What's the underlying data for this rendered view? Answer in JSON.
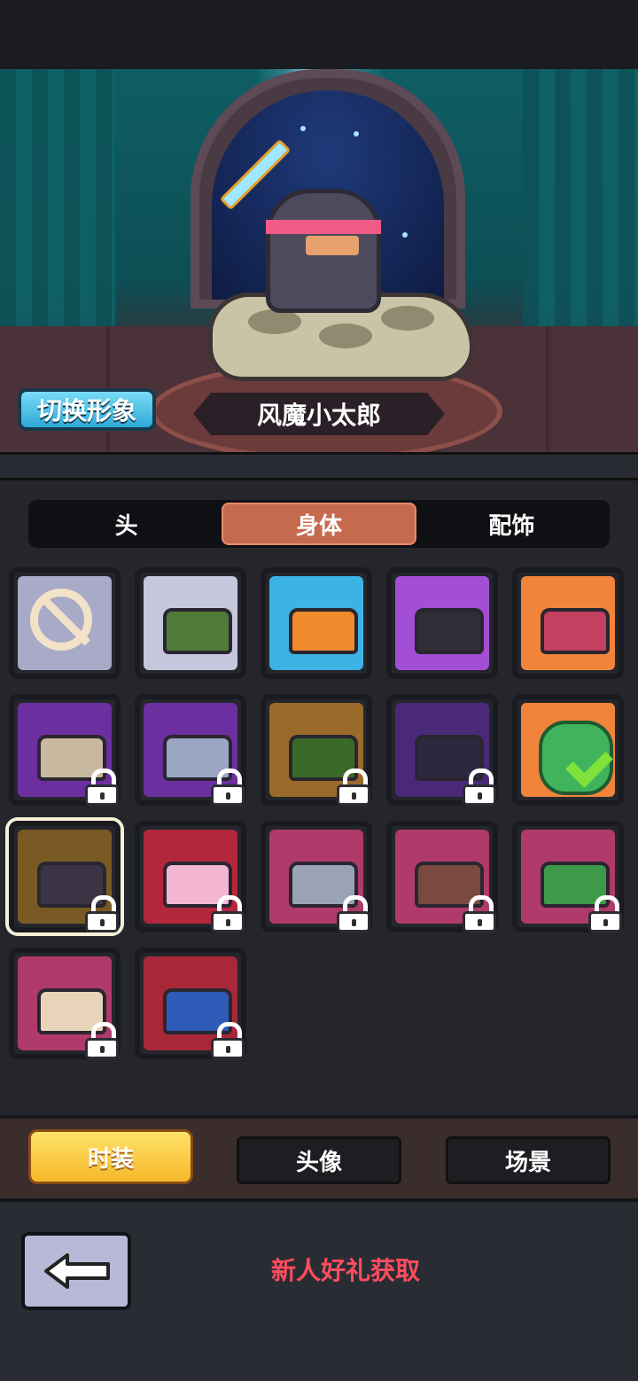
{
  "stage": {
    "switch_button": "切换形象",
    "character_name": "风魔小太郎"
  },
  "tabs": [
    {
      "label": "头",
      "active": false
    },
    {
      "label": "身体",
      "active": true
    },
    {
      "label": "配饰",
      "active": false
    }
  ],
  "grid": {
    "items": [
      {
        "id": "none",
        "locked": false,
        "color": "#a9aac8",
        "icon": "none-icon"
      },
      {
        "id": "green-scarf",
        "locked": false,
        "color": "#c6c7dd",
        "icon": "outfit-icon",
        "accent": "#4f7b3a"
      },
      {
        "id": "orange-cloak",
        "locked": false,
        "color": "#3db2e5",
        "icon": "outfit-icon",
        "accent": "#f08a2c"
      },
      {
        "id": "dark-cloak",
        "locked": false,
        "color": "#a24fd6",
        "icon": "outfit-icon",
        "accent": "#2f2d35"
      },
      {
        "id": "red-cloak",
        "locked": false,
        "color": "#f0843a",
        "icon": "outfit-icon",
        "accent": "#c34060"
      },
      {
        "id": "fish-sword",
        "locked": true,
        "color": "#6b2fa0",
        "icon": "outfit-icon",
        "accent": "#c8b8a0"
      },
      {
        "id": "steel-armor",
        "locked": true,
        "color": "#6b2fa0",
        "icon": "outfit-icon",
        "accent": "#9aa6c4"
      },
      {
        "id": "green-shroud",
        "locked": true,
        "color": "#9a6a2a",
        "icon": "outfit-icon",
        "accent": "#3a6a2a"
      },
      {
        "id": "shadow-cloak",
        "locked": true,
        "color": "#4a2a78",
        "icon": "outfit-icon",
        "accent": "#2b2840"
      },
      {
        "id": "frog-suit",
        "locked": false,
        "equipped": true,
        "color": "#f0843a",
        "icon": "frog-check-icon"
      },
      {
        "id": "ninja-outfit",
        "locked": true,
        "selected": true,
        "color": "#7a5a24",
        "icon": "outfit-icon",
        "accent": "#3b3444"
      },
      {
        "id": "bunny-suit",
        "locked": true,
        "color": "#b3263b",
        "icon": "outfit-icon",
        "accent": "#f2b6d0"
      },
      {
        "id": "knight-armor",
        "locked": true,
        "color": "#b03a6a",
        "icon": "outfit-icon",
        "accent": "#9aa3b6"
      },
      {
        "id": "turkey-suit",
        "locked": true,
        "color": "#b03a6a",
        "icon": "outfit-icon",
        "accent": "#7a4a40"
      },
      {
        "id": "gift-outfit",
        "locked": true,
        "color": "#b03a6a",
        "icon": "outfit-icon",
        "accent": "#3e9a4a"
      },
      {
        "id": "lion-dance",
        "locked": true,
        "color": "#b03a6a",
        "icon": "outfit-icon",
        "accent": "#e8d4b8"
      },
      {
        "id": "fish-suit",
        "locked": true,
        "color": "#a82838",
        "icon": "outfit-icon",
        "accent": "#2f5bb8"
      }
    ]
  },
  "bottom_tabs": [
    {
      "label": "时装",
      "active": true
    },
    {
      "label": "头像",
      "active": false
    },
    {
      "label": "场景",
      "active": false
    }
  ],
  "footer": {
    "promo_text": "新人好礼获取"
  }
}
